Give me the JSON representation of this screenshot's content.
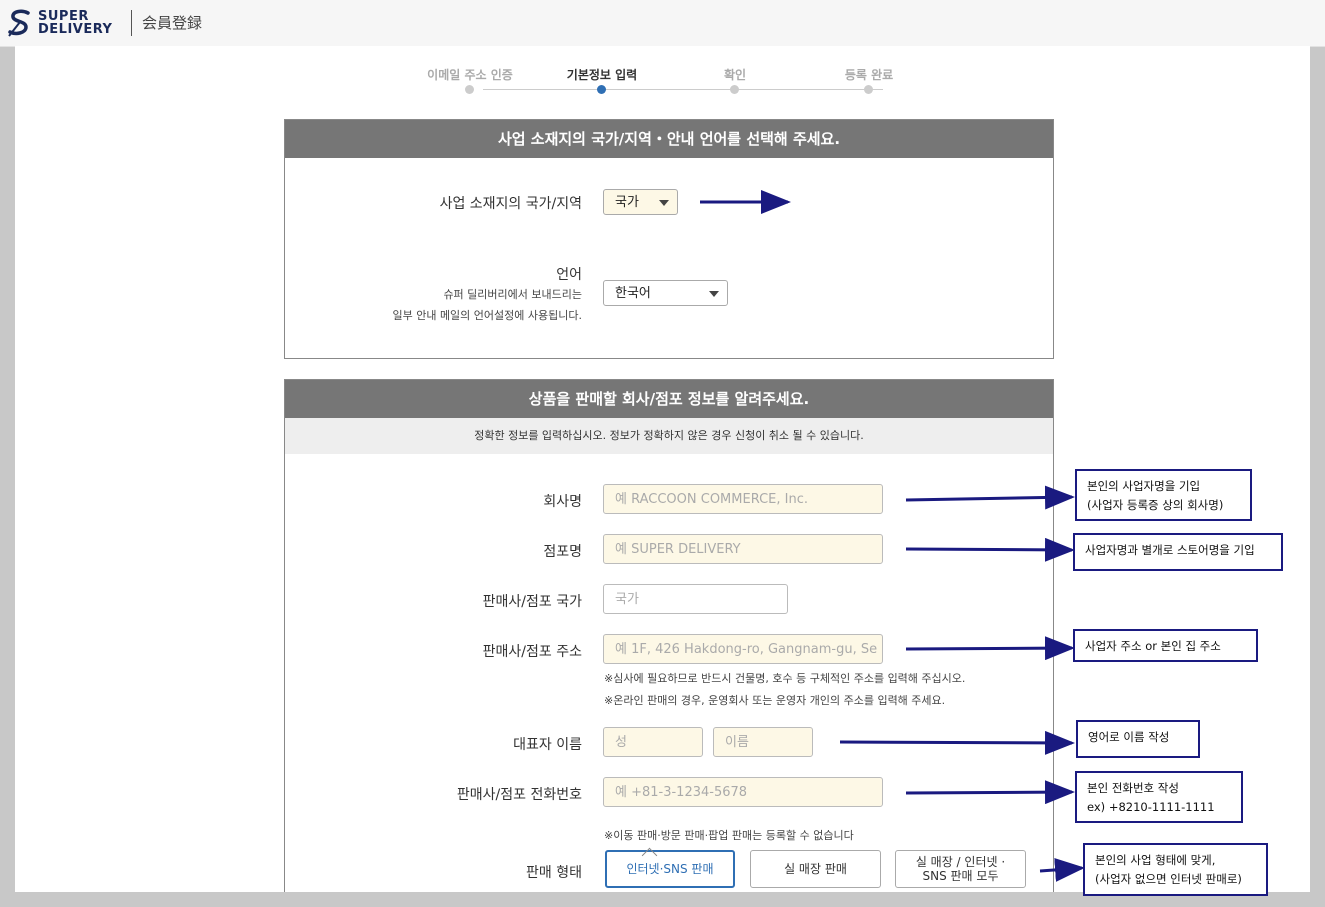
{
  "header": {
    "brand_line1": "SUPER",
    "brand_line2": "DELIVERY",
    "page_title": "会員登録"
  },
  "steps": [
    {
      "label": "이메일 주소 인증",
      "active": false
    },
    {
      "label": "기본정보 입력",
      "active": true
    },
    {
      "label": "확인",
      "active": false
    },
    {
      "label": "등록 완료",
      "active": false
    }
  ],
  "section1": {
    "title": "사업 소재지의 국가/지역・안내 언어를 선택해 주세요.",
    "country_label": "사업 소재지의 국가/지역",
    "country_value": "국가",
    "language_label": "언어",
    "language_note1": "슈퍼 딜리버리에서 보내드리는",
    "language_note2": "일부 안내 메일의 언어설정에 사용됩니다.",
    "language_value": "한국어"
  },
  "section2": {
    "title": "상품을 판매할 회사/점포 정보를 알려주세요.",
    "notice": "정확한 정보를 입력하십시오. 정보가 정확하지 않은 경우 신청이 취소 될 수 있습니다.",
    "company_label": "회사명",
    "company_placeholder": "예 RACCOON COMMERCE, Inc.",
    "store_label": "점포명",
    "store_placeholder": "예 SUPER DELIVERY",
    "store_country_label": "판매사/점포 국가",
    "store_country_placeholder": "국가",
    "address_label": "판매사/점포 주소",
    "address_placeholder": "예 1F, 426 Hakdong-ro, Gangnam-gu, Se",
    "address_hint1": "※심사에 필요하므로 반드시 건물명, 호수 등 구체적인 주소를 입력해 주십시오.",
    "address_hint2": "※온라인 판매의 경우, 운영회사 또는 운영자 개인의 주소를 입력해 주세요.",
    "rep_label": "대표자 이름",
    "rep_last_placeholder": "성",
    "rep_first_placeholder": "이름",
    "phone_label": "판매사/점포 전화번호",
    "phone_placeholder": "예 +81-3-1234-5678",
    "sales_hint": "※이동 판매·방문 판매·팝업 판매는 등록할 수 없습니다",
    "sales_type_label": "판매 형태",
    "sales_types": [
      {
        "label": "인터넷·SNS 판매",
        "active": true
      },
      {
        "label": "실 매장 판매",
        "active": false
      },
      {
        "label_line1": "실 매장 / 인터넷 ·",
        "label_line2": "SNS 판매 모두",
        "active": false
      }
    ]
  },
  "annotations": {
    "company_line1": "본인의 사업자명을 기입",
    "company_line2": "(사업자 등록증 상의 회사명)",
    "store": "사업자명과 별개로 스토어명을 기입",
    "address": "사업자 주소 or 본인 집 주소",
    "rep": "영어로 이름 작성",
    "phone_line1": "본인 전화번호 작성",
    "phone_line2": "ex) +8210-1111-1111",
    "type_line1": "본인의 사업 형태에 맞게,",
    "type_line2": "(사업자 없으면 인터넷 판매로)"
  },
  "colors": {
    "accent": "#2f6fb4",
    "panel_header": "#767676",
    "input_fill": "#fdf8e6",
    "annotation": "#1a1a80"
  }
}
